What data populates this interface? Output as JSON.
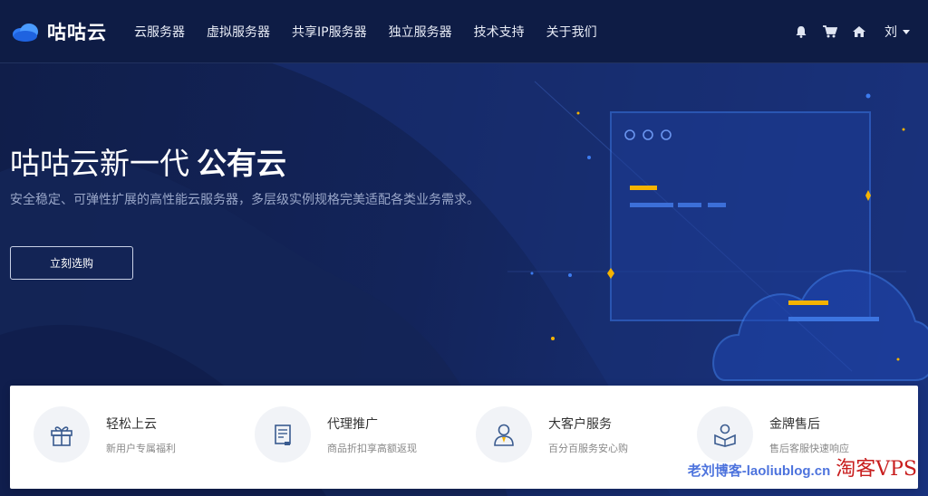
{
  "header": {
    "logo_text": "咕咕云",
    "nav": [
      "云服务器",
      "虚拟服务器",
      "共享IP服务器",
      "独立服务器",
      "技术支持",
      "关于我们"
    ],
    "icons": [
      "bell-icon",
      "cart-icon",
      "home-icon"
    ],
    "user_label": "刘"
  },
  "hero": {
    "title_light": "咕咕云新一代",
    "title_bold": "公有云",
    "subtitle": "安全稳定、可弹性扩展的高性能云服务器，多层级实例规格完美适配各类业务需求。",
    "cta_label": "立刻选购"
  },
  "features": [
    {
      "title": "轻松上云",
      "desc": "新用户专属福利",
      "icon": "gift-icon"
    },
    {
      "title": "代理推广",
      "desc": "商品折扣享高额返现",
      "icon": "document-icon"
    },
    {
      "title": "大客户服务",
      "desc": "百分百服务安心购",
      "icon": "customer-service-icon"
    },
    {
      "title": "金牌售后",
      "desc": "售后客服快速响应",
      "icon": "support-icon"
    }
  ],
  "watermark": {
    "blog": "老刘博客-laoliublog.cn",
    "brand": "淘客VPS"
  },
  "colors": {
    "accent": "#f5b300",
    "header_bg": "#0e1c45",
    "hero_bg": "#13245a",
    "illus_blue": "#2a63d8"
  }
}
